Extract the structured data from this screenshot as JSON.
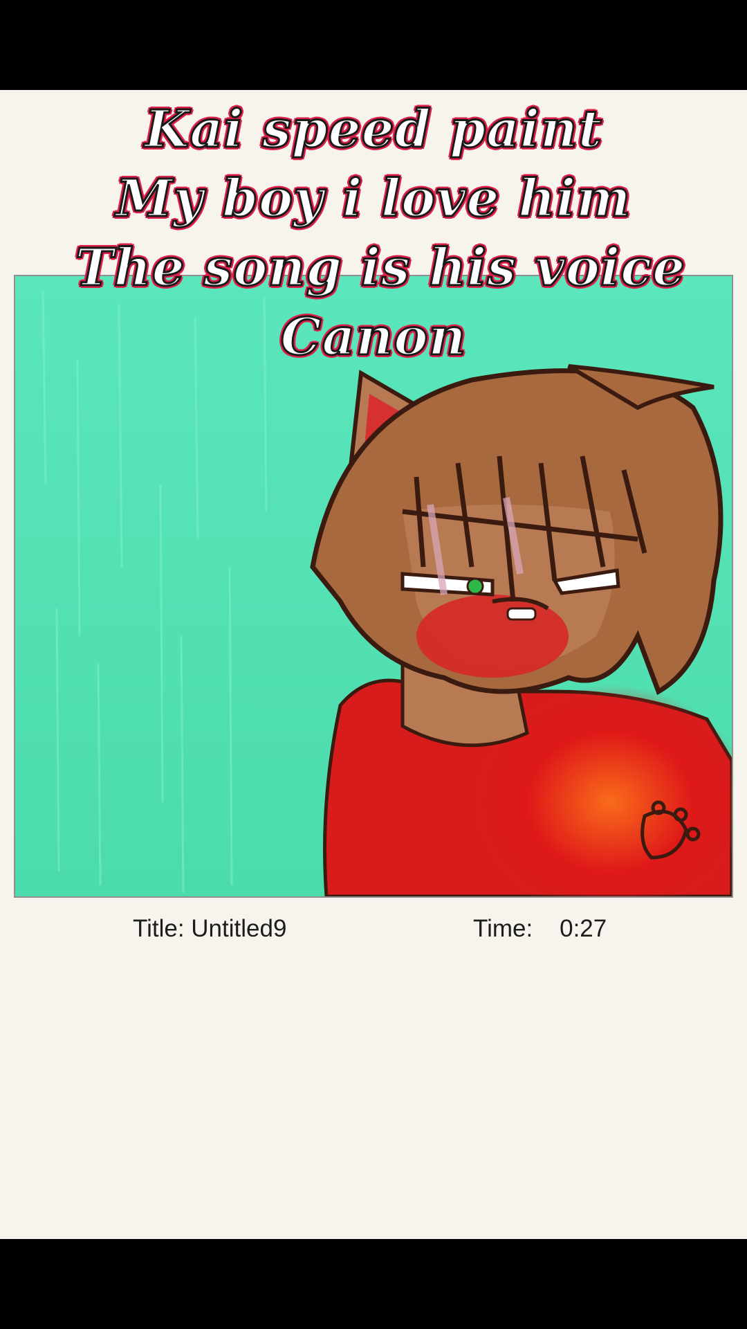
{
  "overlay_captions": [
    "Kai speed paint",
    "My boy i love him",
    "The song is his voice",
    "Canon"
  ],
  "drawing_info": {
    "title_label": "Title:",
    "title_value": "Untitled9",
    "time_label": "Time:",
    "time_value": "0:27"
  },
  "colors": {
    "canvas_background": "#52e3b4",
    "hair": "#a8693f",
    "skin": "#b87a52",
    "ear_inner": "#d63030",
    "shirt": "#d81c1c",
    "eye_green": "#2fb84a",
    "caption_outline": "#e0204a",
    "paper": "#f7f4ee"
  }
}
